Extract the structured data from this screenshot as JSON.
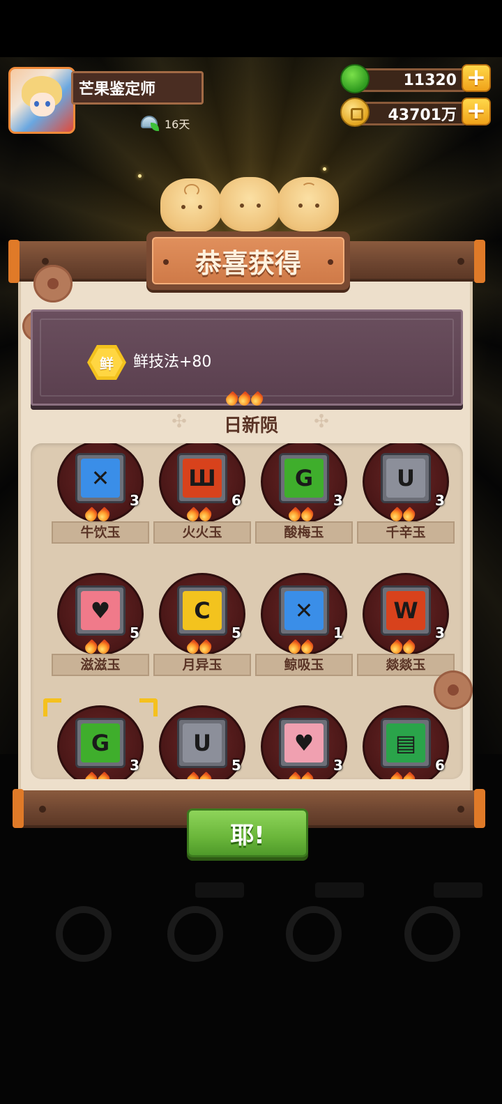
{
  "player": {
    "name": "芒果鉴定师",
    "days": "16天"
  },
  "currency": {
    "jade": "11320",
    "coins": "43701万",
    "add_symbol": "+"
  },
  "dialog": {
    "title": "恭喜获得",
    "reward": {
      "badge": "鲜",
      "text": "鲜技法+80"
    },
    "set_name": "日新陨",
    "items": [
      {
        "name": "牛饮玉",
        "count": "3",
        "color": "#3a8ee8",
        "glyph": "✕"
      },
      {
        "name": "火火玉",
        "count": "6",
        "color": "#d8421c",
        "glyph": "Ш"
      },
      {
        "name": "酸梅玉",
        "count": "3",
        "color": "#3fae2c",
        "glyph": "G"
      },
      {
        "name": "千辛玉",
        "count": "3",
        "color": "#8c8f9a",
        "glyph": "U"
      },
      {
        "name": "滋滋玉",
        "count": "5",
        "color": "#f07a8a",
        "glyph": "♥"
      },
      {
        "name": "月异玉",
        "count": "5",
        "color": "#f3c31e",
        "glyph": "C"
      },
      {
        "name": "鲸吸玉",
        "count": "1",
        "color": "#3a8ee8",
        "glyph": "✕"
      },
      {
        "name": "燚燚玉",
        "count": "3",
        "color": "#d8421c",
        "glyph": "W"
      },
      {
        "name": "",
        "count": "3",
        "color": "#3fae2c",
        "glyph": "G"
      },
      {
        "name": "",
        "count": "5",
        "color": "#8c8f9a",
        "glyph": "U"
      },
      {
        "name": "",
        "count": "3",
        "color": "#f0a0b0",
        "glyph": "♥"
      },
      {
        "name": "",
        "count": "6",
        "color": "#2aa44a",
        "glyph": "▤"
      }
    ],
    "confirm_label": "耶!"
  }
}
